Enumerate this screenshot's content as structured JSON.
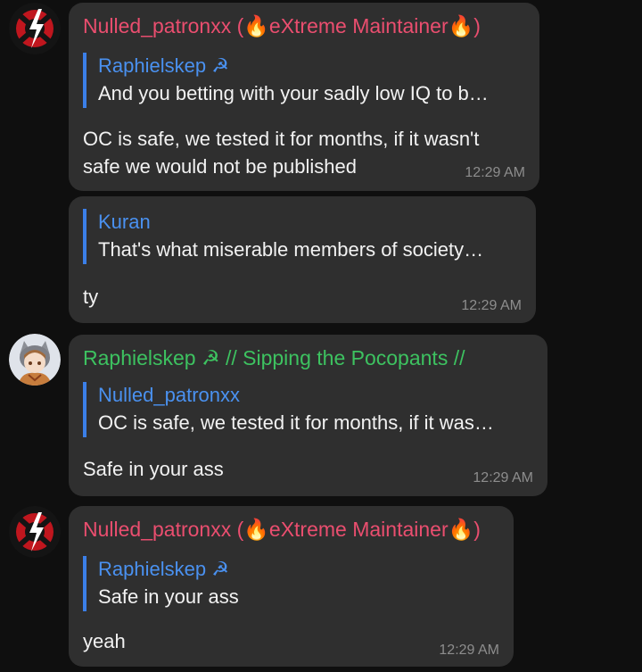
{
  "messages": [
    {
      "sender": "Nulled_patronxx (🔥eXtreme Maintainer🔥)",
      "reply_name": "Raphielskep ☭",
      "reply_text": "And you betting with your sadly low IQ to b…",
      "text": "OC is safe, we tested it for months, if it wasn't\nsafe we would not be published",
      "time": "12:29 AM"
    },
    {
      "reply_name": "Kuran",
      "reply_text": "That's what miserable members of society…",
      "text": "ty",
      "time": "12:29 AM"
    },
    {
      "sender": "Raphielskep ☭ // Sipping the Pocopants //",
      "reply_name": "Nulled_patronxx",
      "reply_text": "OC is safe, we tested it for months, if it was…",
      "text": "Safe in your ass",
      "time": "12:29 AM"
    },
    {
      "sender": "Nulled_patronxx (🔥eXtreme Maintainer🔥)",
      "reply_name": "Raphielskep ☭",
      "reply_text": "Safe in your ass",
      "text": "yeah",
      "time": "12:29 AM"
    }
  ],
  "colors": {
    "background": "#0f0f0f",
    "bubble": "#2f2f2f",
    "sender_red": "#ea4e6f",
    "sender_green": "#3dc260",
    "reply_accent": "#3b7fe8",
    "reply_name": "#4a91f0",
    "time": "#8d8d8d"
  },
  "icons": [
    "anarchy-logo-avatar",
    "anime-character-avatar"
  ]
}
